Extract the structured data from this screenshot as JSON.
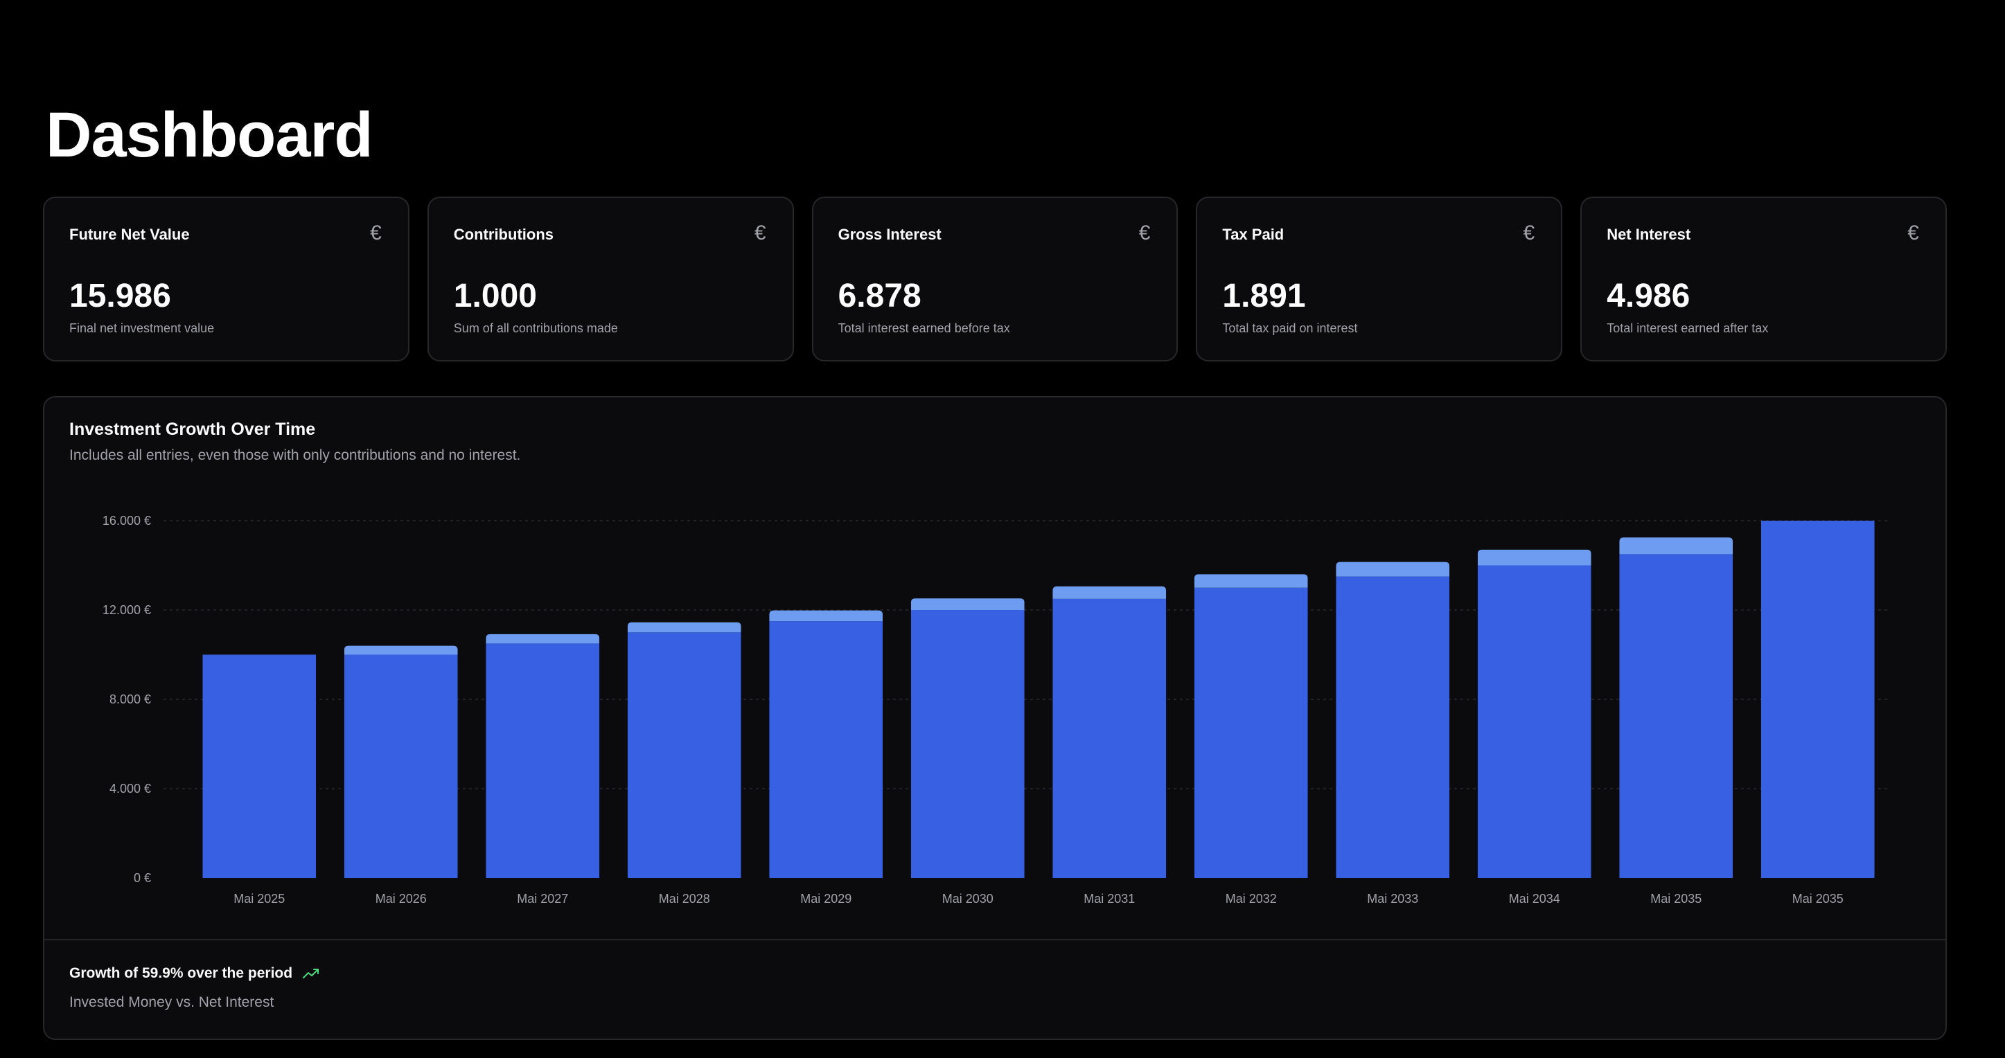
{
  "page": {
    "title": "Dashboard"
  },
  "cards": [
    {
      "title": "Future Net Value",
      "value": "15.986",
      "description": "Final net investment value",
      "icon": "euro-icon"
    },
    {
      "title": "Contributions",
      "value": "1.000",
      "description": "Sum of all contributions made",
      "icon": "euro-icon"
    },
    {
      "title": "Gross Interest",
      "value": "6.878",
      "description": "Total interest earned before tax",
      "icon": "euro-icon"
    },
    {
      "title": "Tax Paid",
      "value": "1.891",
      "description": "Total tax paid on interest",
      "icon": "euro-icon"
    },
    {
      "title": "Net Interest",
      "value": "4.986",
      "description": "Total interest earned after tax",
      "icon": "euro-icon"
    }
  ],
  "card_icon_glyph": "€",
  "chart": {
    "title": "Investment Growth Over Time",
    "subtitle": "Includes all entries, even those with only contributions and no interest.",
    "footer": {
      "growth_text": "Growth of 59.9% over the period",
      "caption": "Invested Money vs. Net Interest",
      "trend_icon": "trending-up-icon"
    }
  },
  "colors": {
    "background": "#000000",
    "card_background": "#0b0b0d",
    "card_border": "#27272a",
    "bar_invested": "#3860e2",
    "bar_interest": "#6d9cf0",
    "grid": "#2a2a2e",
    "muted_text": "#a1a1aa",
    "trend_green": "#4ade80"
  },
  "chart_data": {
    "type": "bar",
    "stacked": true,
    "categories": [
      "Mai 2025",
      "Mai 2026",
      "Mai 2027",
      "Mai 2028",
      "Mai 2029",
      "Mai 2030",
      "Mai 2031",
      "Mai 2032",
      "Mai 2033",
      "Mai 2034",
      "Mai 2035",
      "Mai 2035"
    ],
    "series": [
      {
        "values": [
          10000,
          10000,
          10500,
          11000,
          11500,
          12000,
          12500,
          13000,
          13500,
          14000,
          14500,
          16000
        ]
      },
      {
        "values": [
          0,
          400,
          420,
          450,
          480,
          520,
          560,
          600,
          650,
          700,
          750,
          0
        ]
      }
    ],
    "y_ticks": [
      "0 €",
      "4.000 €",
      "8.000 €",
      "12.000 €",
      "16.000 €"
    ],
    "y_tick_values": [
      0,
      4000,
      8000,
      12000,
      16000
    ],
    "ylim": [
      0,
      16000
    ],
    "grid": true,
    "legend": "none"
  }
}
